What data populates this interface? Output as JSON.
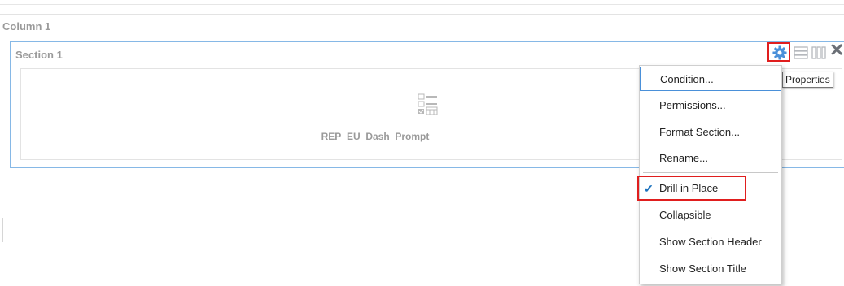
{
  "column": {
    "title": "Column 1"
  },
  "section": {
    "title": "Section 1"
  },
  "prompt": {
    "name": "REP_EU_Dash_Prompt",
    "icon": "dashboard-prompt-icon"
  },
  "toolbar": {
    "properties_tooltip": "Properties",
    "icons": [
      "gear-icon",
      "rows-layout-icon",
      "columns-layout-icon",
      "close-icon"
    ]
  },
  "menu": {
    "items": [
      {
        "label": "Condition...",
        "checked": false
      },
      {
        "label": "Permissions...",
        "checked": false
      },
      {
        "label": "Format Section...",
        "checked": false
      },
      {
        "label": "Rename...",
        "checked": false
      },
      {
        "label": "Drill in Place",
        "checked": true
      },
      {
        "label": "Collapsible",
        "checked": false
      },
      {
        "label": "Show Section Header",
        "checked": false
      },
      {
        "label": "Show Section Title",
        "checked": false
      }
    ]
  },
  "colors": {
    "accent": "#1e73be",
    "highlight": "#e01e1e",
    "section_border": "#86b8e6",
    "gear": "#4a90d9"
  }
}
